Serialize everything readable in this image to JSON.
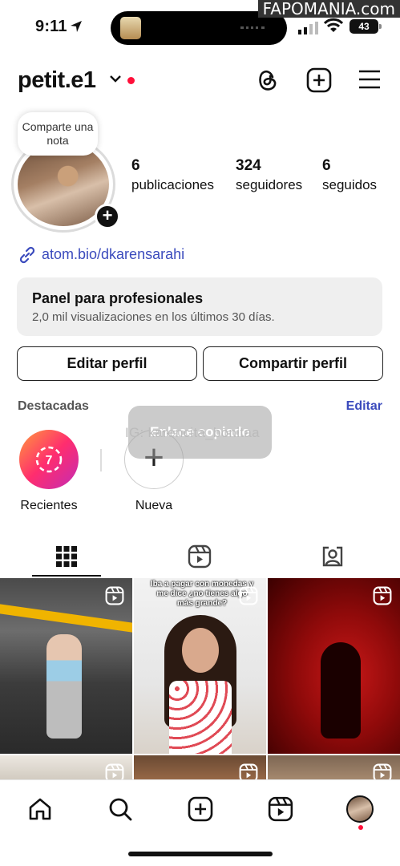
{
  "status_bar": {
    "time": "9:11",
    "battery": "43"
  },
  "watermark": "FAPOMANIA.com",
  "header": {
    "username": "petit.e1"
  },
  "note_bubble": {
    "text": "Comparte una nota"
  },
  "stats": [
    {
      "value": "6",
      "label": "publicaciones"
    },
    {
      "value": "324",
      "label": "seguidores"
    },
    {
      "value": "6",
      "label": "seguidos"
    }
  ],
  "bio_link": "atom.bio/dkarensarahi",
  "dashboard": {
    "title": "Panel para profesionales",
    "subtitle": "2,0 mil visualizaciones en los últimos 30 días."
  },
  "buttons": {
    "edit": "Editar perfil",
    "share": "Compartir perfil"
  },
  "highlights": {
    "title": "Destacadas",
    "edit": "Editar",
    "items": [
      {
        "label": "Recientes",
        "badge": "7"
      },
      {
        "label": "Nueva",
        "symbol": "+"
      }
    ]
  },
  "toast": "Enlace copiado",
  "overlay_watermark": "IG: karencita_bonitaa",
  "posts": {
    "post2_caption": "Iba a pagar con monedas y me dice ¿no tienes algo más grande?"
  },
  "colors": {
    "accent_blue": "#3b4bbd",
    "notification_red": "#ff0f39"
  }
}
